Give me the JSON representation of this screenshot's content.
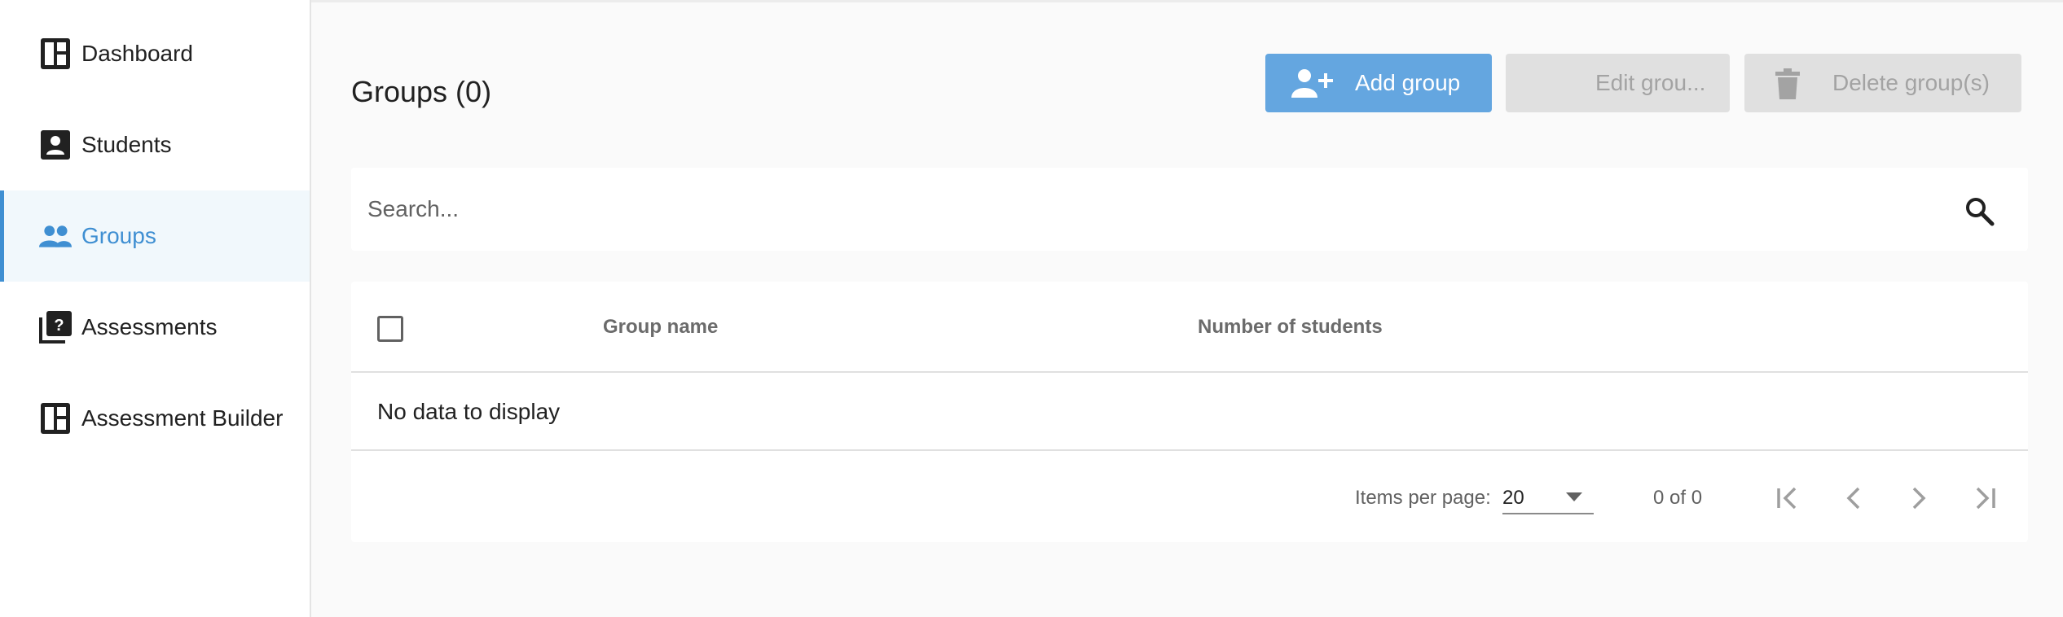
{
  "sidebar": {
    "items": [
      {
        "label": "Dashboard",
        "icon": "dashboard-icon"
      },
      {
        "label": "Students",
        "icon": "student-badge-icon"
      },
      {
        "label": "Groups",
        "icon": "people-icon",
        "active": true
      },
      {
        "label": "Assessments",
        "icon": "quiz-icon"
      },
      {
        "label": "Assessment Builder",
        "icon": "dashboard-icon"
      }
    ]
  },
  "header": {
    "title": "Groups (0)",
    "add_label": "Add group",
    "edit_label": "Edit grou...",
    "delete_label": "Delete group(s)"
  },
  "search": {
    "placeholder": "Search...",
    "value": ""
  },
  "table": {
    "columns": [
      "Group name",
      "Number of students"
    ],
    "empty_message": "No data to display"
  },
  "paginator": {
    "items_per_page_label": "Items per page:",
    "items_per_page_value": "20",
    "range_label": "0 of 0"
  },
  "colors": {
    "accent": "#3f8fd2",
    "primary_button": "#64a6e0",
    "disabled_button": "#e0e0e0",
    "active_nav_bg": "#f1f8fc"
  }
}
